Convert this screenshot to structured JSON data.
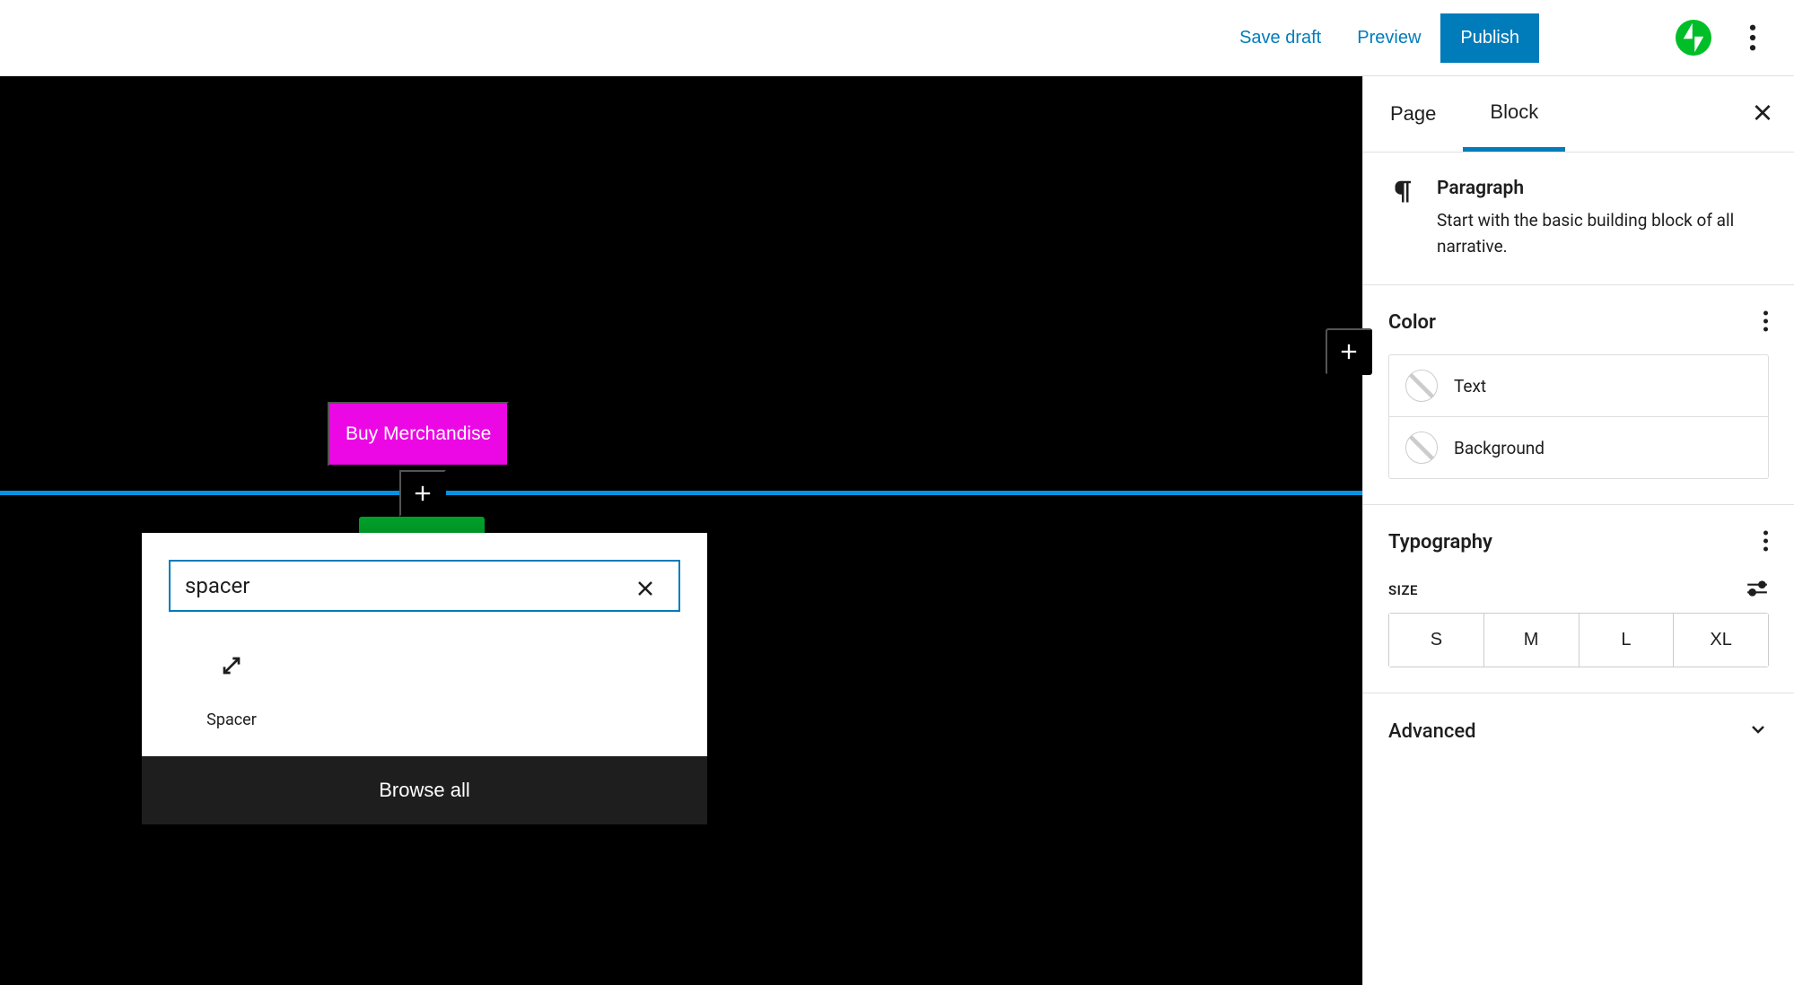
{
  "toolbar": {
    "save_draft": "Save draft",
    "preview": "Preview",
    "publish": "Publish"
  },
  "editor": {
    "buy_merch_label": "Buy Merchandise"
  },
  "inserter": {
    "search_value": "spacer",
    "result_label": "Spacer",
    "browse_all": "Browse all"
  },
  "sidebar": {
    "tabs": {
      "page": "Page",
      "block": "Block"
    },
    "block": {
      "title": "Paragraph",
      "description": "Start with the basic building block of all narrative."
    },
    "color": {
      "heading": "Color",
      "text": "Text",
      "background": "Background"
    },
    "typography": {
      "heading": "Typography",
      "size_label": "SIZE",
      "sizes": [
        "S",
        "M",
        "L",
        "XL"
      ]
    },
    "advanced": "Advanced"
  }
}
